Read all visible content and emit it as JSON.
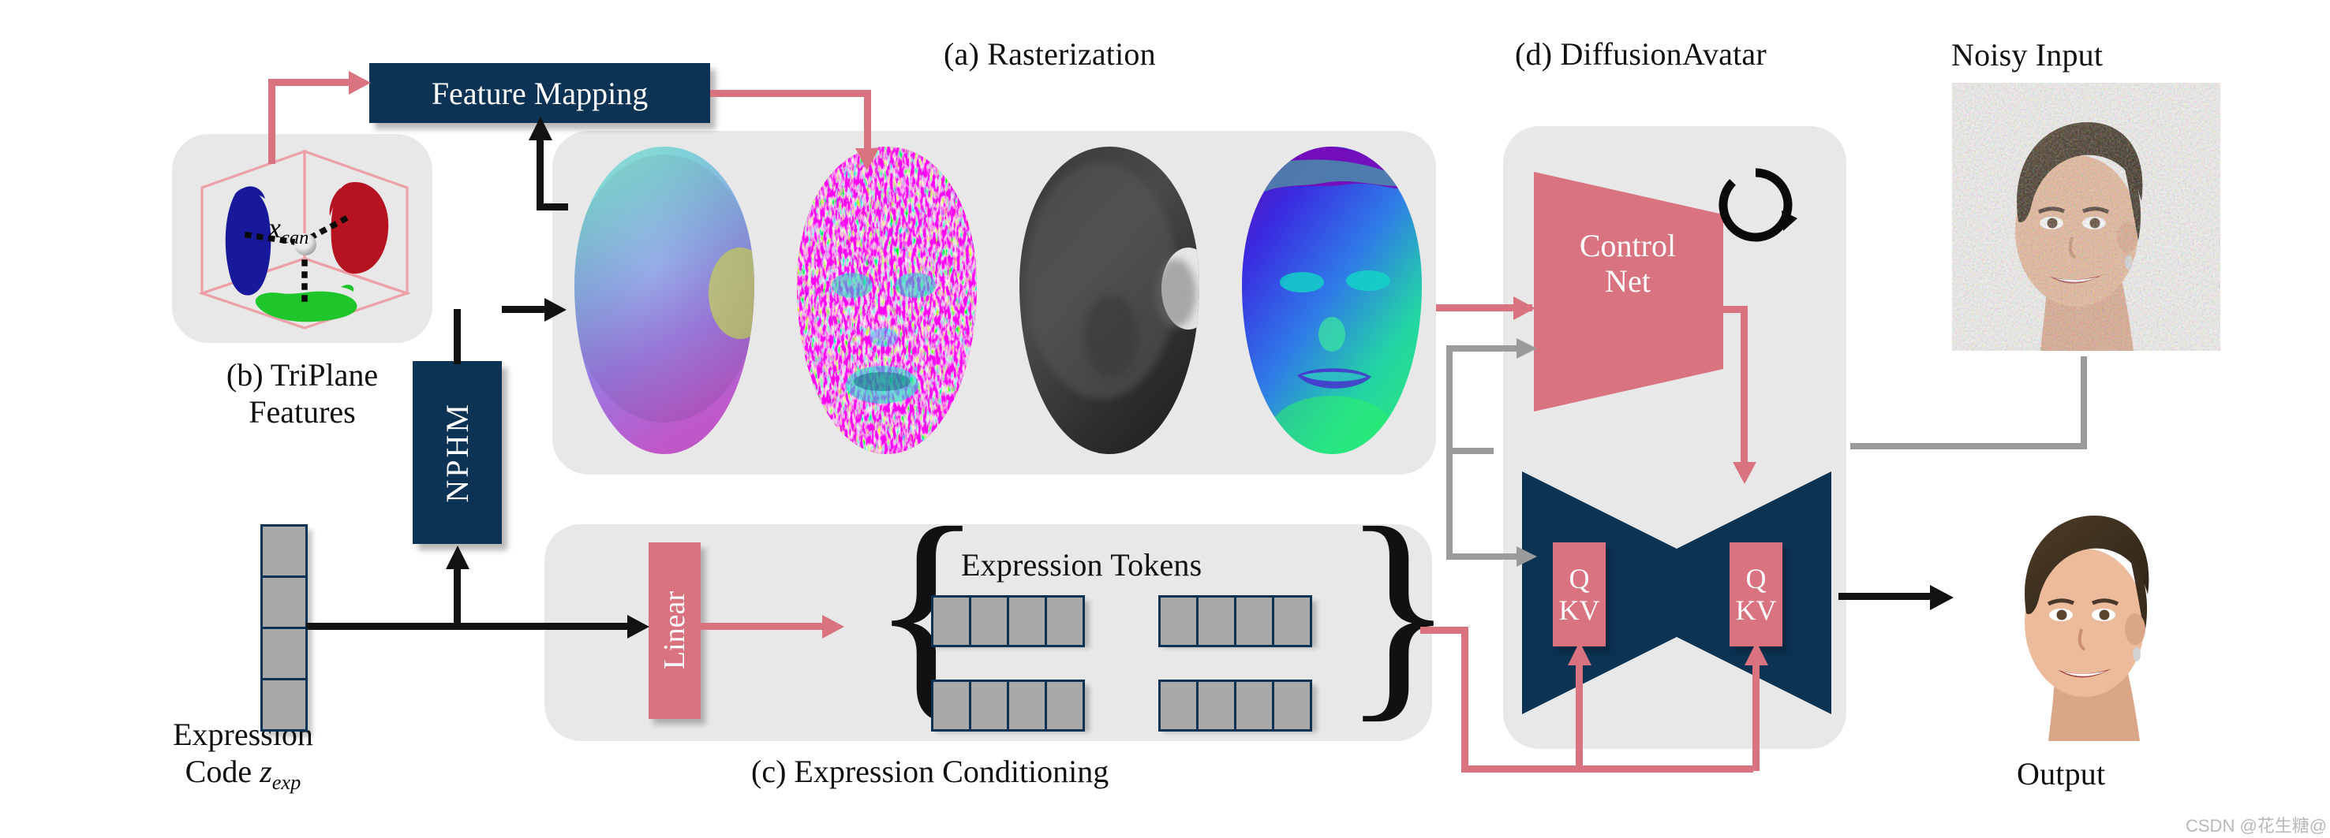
{
  "figure": {
    "watermark": "CSDN @花生糖@"
  },
  "panels": {
    "rasterization": {
      "title": "(a) Rasterization"
    },
    "triplane": {
      "caption_line1": "(b) TriPlane",
      "caption_line2": "Features",
      "point_label": "x_can"
    },
    "expression": {
      "caption": "(c) Expression Conditioning",
      "tokens_title": "Expression Tokens"
    },
    "diffusion": {
      "title": "(d) DiffusionAvatar"
    }
  },
  "blocks": {
    "feature_mapping": "Feature Mapping",
    "nphm": "NPHM",
    "linear": "Linear",
    "controlnet_line1": "Control",
    "controlnet_line2": "Net",
    "attn_q": "Q",
    "attn_kv": "KV"
  },
  "labels": {
    "expression_code_line1": "Expression",
    "expression_code_line2": "Code z_exp",
    "noisy_input": "Noisy Input",
    "output": "Output"
  },
  "icons": {
    "loop": "recycle-loop-icon"
  },
  "colors": {
    "navy": "#0c3354",
    "pink": "#d9737f",
    "panel_gray": "#e8e8e8",
    "cell_gray": "#a9a9a9",
    "arrow_black": "#121212",
    "arrow_gray": "#9b9b9b"
  },
  "expression_code_cells": [
    "",
    "",
    "",
    ""
  ],
  "expression_token_groups": [
    {
      "cells": [
        "",
        "",
        "",
        ""
      ]
    },
    {
      "cells": [
        "",
        "",
        "",
        ""
      ]
    },
    {
      "cells": [
        "",
        "",
        "",
        ""
      ]
    },
    {
      "cells": [
        "",
        "",
        "",
        ""
      ]
    }
  ],
  "rasterization_maps": [
    {
      "name": "canonical-coordinate-map"
    },
    {
      "name": "feature-map"
    },
    {
      "name": "depth-map"
    },
    {
      "name": "normal-map"
    }
  ]
}
